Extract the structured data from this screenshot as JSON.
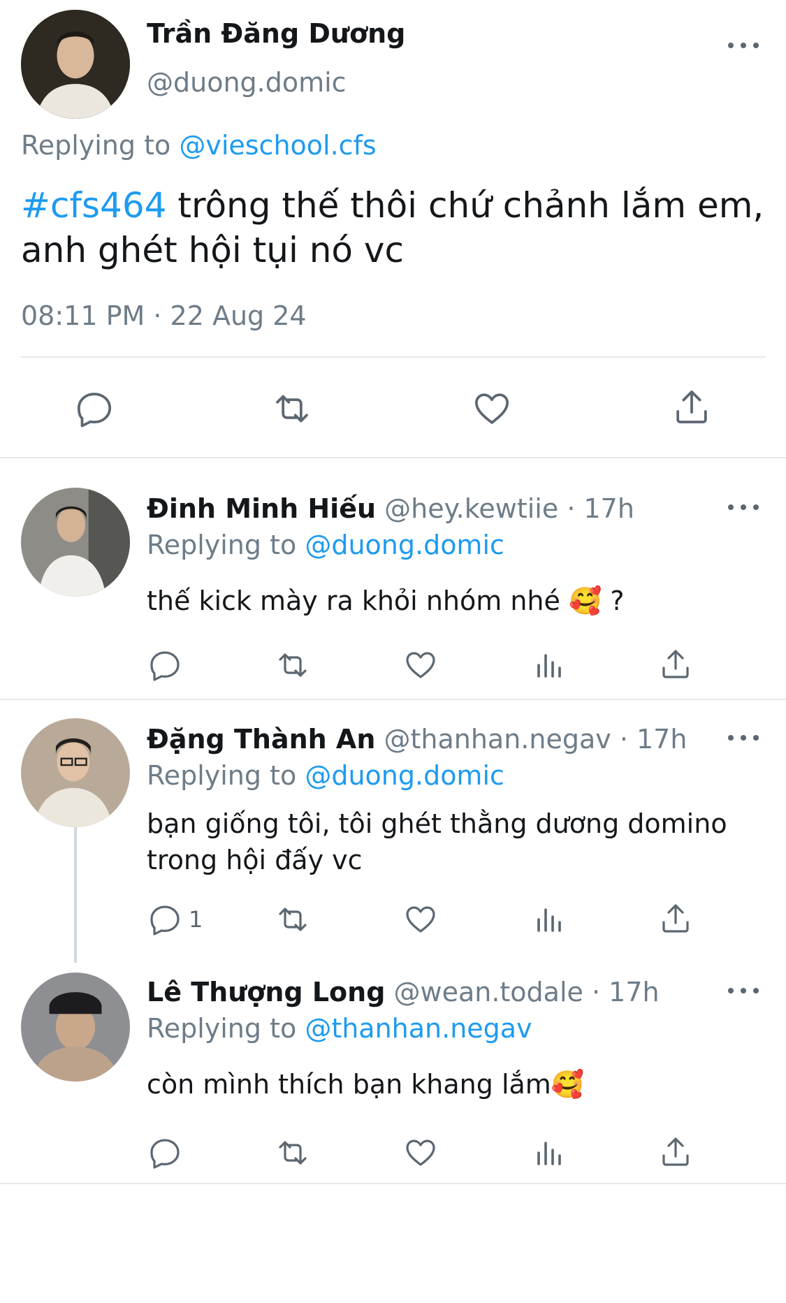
{
  "main_tweet": {
    "author_name": "Trần Đăng Dương",
    "handle": "@duong.domic",
    "replying_prefix": "Replying to",
    "replying_to": "@vieschool.cfs",
    "hashtag": "#cfs464",
    "text_line1": " trông thế thôi chứ chảnh lắm em,",
    "text_line2": "anh ghét hội tụi nó vc",
    "timestamp": "08:11 PM · 22 Aug 24"
  },
  "replies": [
    {
      "author_name": "Đinh Minh Hiếu",
      "handle": "@hey.kewtiie",
      "time": " · 17h",
      "replying_prefix": "Replying to",
      "replying_to": "@duong.domic",
      "text_line1": "thế kick mày ra khỏi nhóm nhé 🥰 ?",
      "reply_count": ""
    },
    {
      "author_name": "Đặng Thành An",
      "handle": "@thanhan.negav",
      "time": " · 17h",
      "replying_prefix": "Replying to",
      "replying_to": "@duong.domic",
      "text_line1": "bạn giống tôi, tôi ghét thằng dương domino",
      "text_line2": "trong hội đấy vc",
      "reply_count": "1"
    },
    {
      "author_name": "Lê Thượng Long",
      "handle": "@wean.todale",
      "time": " · 17h",
      "replying_prefix": "Replying to",
      "replying_to": "@thanhan.negav",
      "text_line1": "còn mình thích bạn khang lắm🥰",
      "reply_count": ""
    }
  ],
  "icons": {
    "reply": "reply-icon",
    "retweet": "retweet-icon",
    "like": "heart-icon",
    "analytics": "analytics-icon",
    "share": "share-icon",
    "more": "more-icon"
  },
  "colors": {
    "accent": "#1d9bf0",
    "secondary_text": "#6e7c88",
    "divider": "#e6e9ec"
  }
}
